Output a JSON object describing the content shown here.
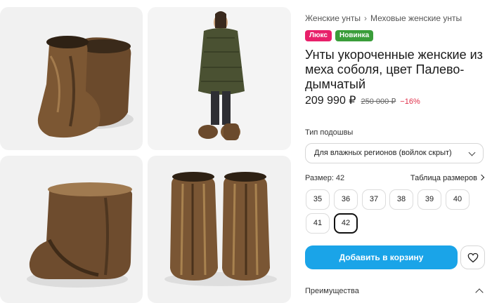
{
  "breadcrumb": {
    "item1": "Женские унты",
    "separator": "›",
    "item2": "Меховые женские унты"
  },
  "badges": {
    "lux": "Люкс",
    "new": "Новинка"
  },
  "product": {
    "title": "Унты укороченные женские из меха соболя, цвет Палево-дымчатый",
    "price": "209 990 ₽",
    "old_price": "250 000 ₽",
    "discount": "−16%"
  },
  "sole": {
    "label": "Тип подошвы",
    "selected": "Для влажных регионов (войлок скрыт)"
  },
  "size": {
    "label": "Размер: 42",
    "table_link": "Таблица размеров",
    "options": [
      "35",
      "36",
      "37",
      "38",
      "39",
      "40",
      "41",
      "42"
    ],
    "selected": "42"
  },
  "actions": {
    "add_to_cart": "Добавить в корзину",
    "favorite_icon": "heart-icon"
  },
  "advantages": {
    "label": "Преимущества"
  },
  "icons": [
    "chevron-down-icon",
    "chevron-right-icon",
    "heart-icon",
    "chevron-up-icon"
  ],
  "colors": {
    "accent": "#1aa4e8",
    "lux_badge": "#e8206a",
    "new_badge": "#3a9d3a",
    "discount": "#e0304a"
  }
}
